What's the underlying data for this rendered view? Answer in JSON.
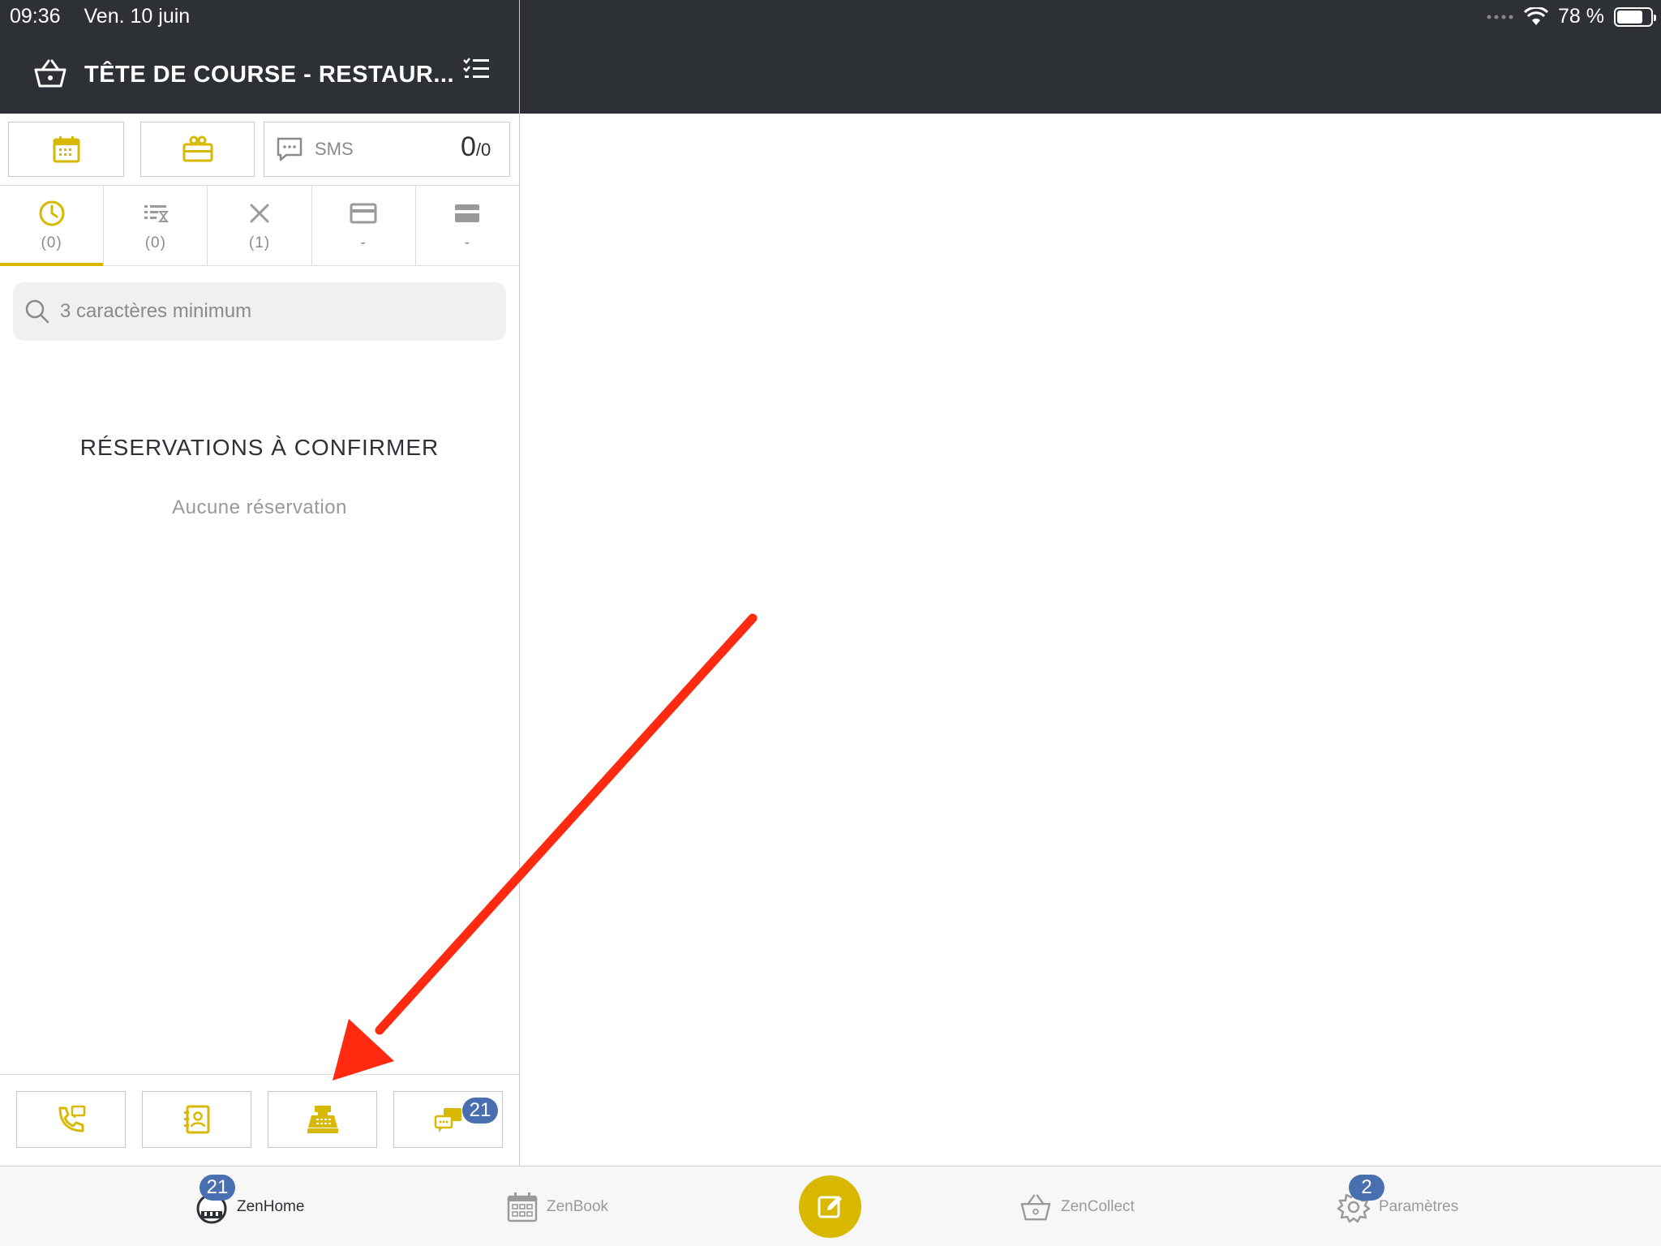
{
  "status_bar": {
    "time": "09:36",
    "date": "Ven. 10 juin",
    "battery": "78 %",
    "battery_level": 0.78
  },
  "header": {
    "title": "TÊTE DE COURSE - RESTAUR..."
  },
  "top_buttons": {
    "sms_label": "SMS",
    "sms_count": "0",
    "sms_total": "/0"
  },
  "filter_tabs": [
    {
      "name": "pending",
      "count": "(0)",
      "active": true
    },
    {
      "name": "waitlist",
      "count": "(0)",
      "active": false
    },
    {
      "name": "cancelled",
      "count": "(1)",
      "active": false
    },
    {
      "name": "card",
      "count": "-",
      "active": false
    },
    {
      "name": "payment",
      "count": "-",
      "active": false
    }
  ],
  "search": {
    "placeholder": "3 caractères minimum"
  },
  "reservations": {
    "title": "RÉSERVATIONS À CONFIRMER",
    "empty": "Aucune réservation"
  },
  "bottom_buttons": {
    "messages_badge": "21"
  },
  "tabbar": {
    "items": [
      {
        "label": "ZenHome",
        "badge": "21",
        "active": true
      },
      {
        "label": "ZenBook",
        "badge": "",
        "active": false
      },
      {
        "label": "ZenCollect",
        "badge": "",
        "active": false
      },
      {
        "label": "Paramètres",
        "badge": "2",
        "active": false
      }
    ]
  },
  "colors": {
    "header_bg": "#2d3136",
    "accent": "#d8b800",
    "badge": "#4a6fb0",
    "annotation_arrow": "#ff2a10"
  }
}
